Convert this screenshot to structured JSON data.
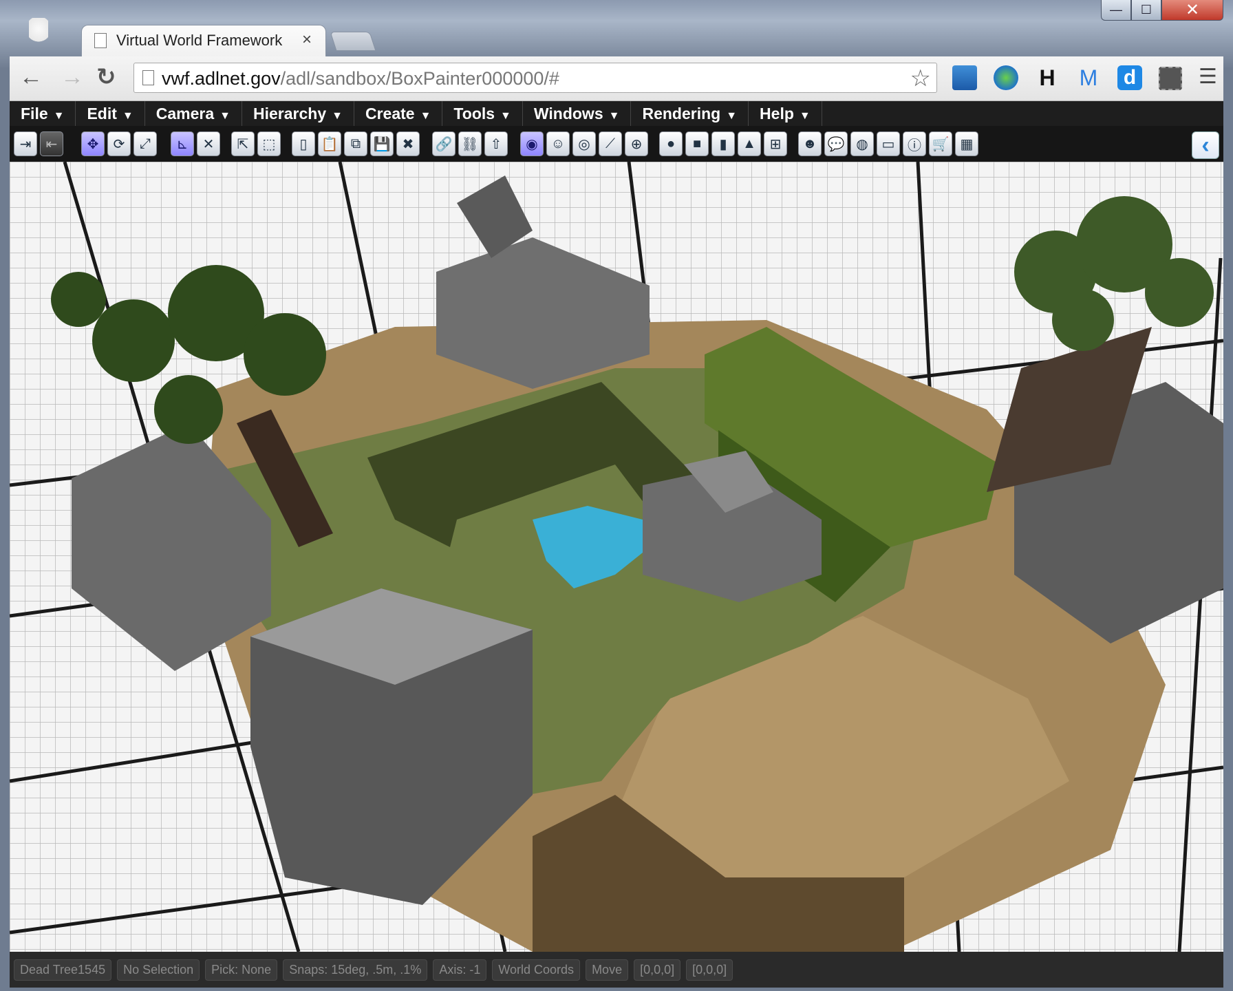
{
  "browser": {
    "tab_title": "Virtual World Framework",
    "tab_close": "×",
    "url_host": "vwf.adlnet.gov",
    "url_path": "/adl/sandbox/BoxPainter000000/#",
    "back": "←",
    "forward": "→",
    "reload": "↻",
    "star": "☆",
    "menu": "☰",
    "minimize": "—",
    "maximize": "☐",
    "close": "✕",
    "extensions": {
      "h": "H",
      "m": "M",
      "d": "d"
    }
  },
  "menubar": [
    {
      "label": "File"
    },
    {
      "label": "Edit"
    },
    {
      "label": "Camera"
    },
    {
      "label": "Hierarchy"
    },
    {
      "label": "Create"
    },
    {
      "label": "Tools"
    },
    {
      "label": "Windows"
    },
    {
      "label": "Rendering"
    },
    {
      "label": "Help"
    }
  ],
  "menu_caret": "▼",
  "sidebar_toggle": "‹",
  "status": [
    {
      "label": "Dead Tree1545"
    },
    {
      "label": "No Selection"
    },
    {
      "label": "Pick: None"
    },
    {
      "label": "Snaps: 15deg, .5m, .1%"
    },
    {
      "label": "Axis: -1"
    },
    {
      "label": "World Coords"
    },
    {
      "label": "Move"
    },
    {
      "label": "[0,0,0]"
    },
    {
      "label": "[0,0,0]"
    }
  ],
  "colors": {
    "menubar_bg": "#1e1e1e",
    "grass": "#6f7d44",
    "dirt": "#a88a5e",
    "stone": "#7a7a7a",
    "water": "#3ab0d6",
    "grid_line": "#202020"
  }
}
